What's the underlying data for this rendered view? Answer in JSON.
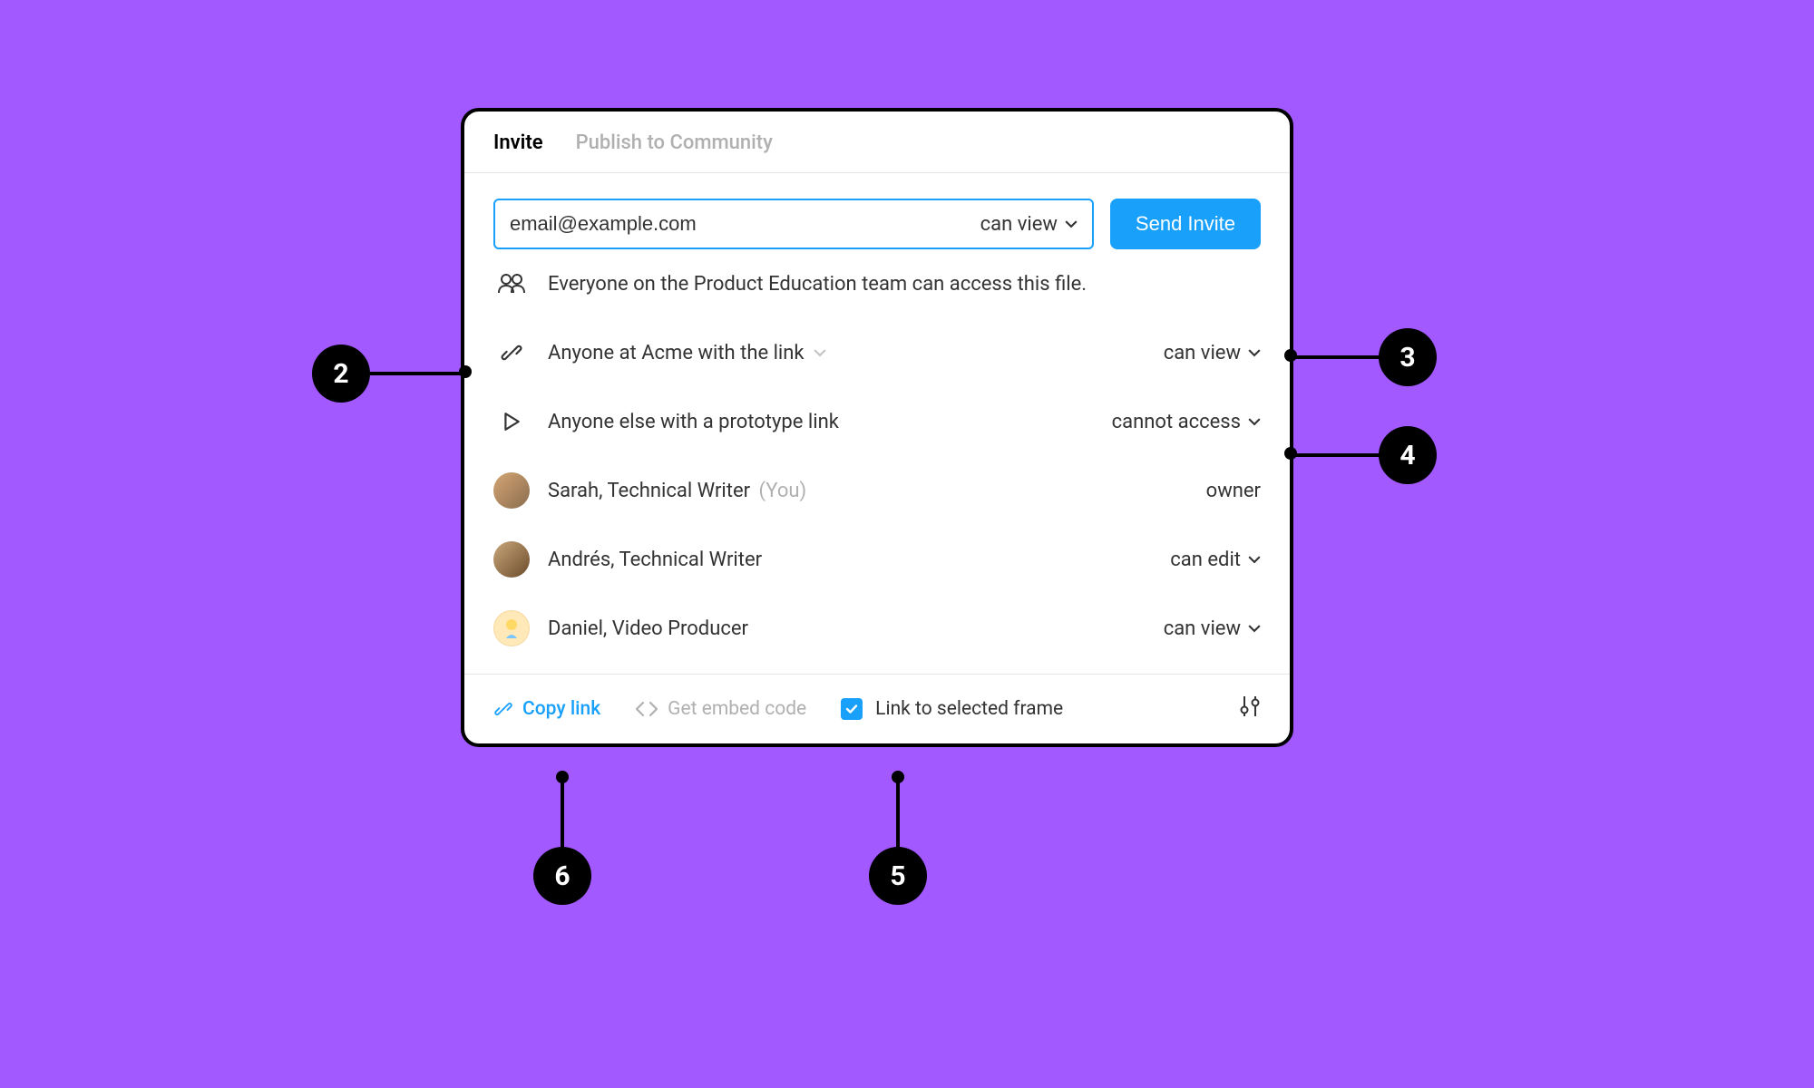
{
  "tabs": {
    "invite": "Invite",
    "publish": "Publish to Community"
  },
  "invite": {
    "email_placeholder": "email@example.com",
    "default_permission": "can view",
    "send_button": "Send Invite"
  },
  "team_access": {
    "text": "Everyone on the Product Education team can access this file."
  },
  "link_access": {
    "label": "Anyone at Acme with the link",
    "permission": "can view"
  },
  "prototype_access": {
    "label": "Anyone else with a prototype link",
    "permission": "cannot access"
  },
  "members": [
    {
      "name": "Sarah, Technical Writer",
      "you": "(You)",
      "permission": "owner",
      "static": true,
      "avatar_bg": "#d4a574"
    },
    {
      "name": "Andrés, Technical Writer",
      "you": "",
      "permission": "can edit",
      "static": false,
      "avatar_bg": "#c9a87c"
    },
    {
      "name": "Daniel, Video Producer",
      "you": "",
      "permission": "can view",
      "static": false,
      "avatar_bg": "#ffe9b8"
    }
  ],
  "footer": {
    "copy_link": "Copy link",
    "embed": "Get embed code",
    "link_frame": "Link to selected frame",
    "link_frame_checked": true
  },
  "annotations": {
    "2": "2",
    "3": "3",
    "4": "4",
    "5": "5",
    "6": "6"
  },
  "colors": {
    "background": "#a259ff",
    "accent": "#18a0fb",
    "text": "#333333",
    "muted": "#b0b0b0"
  }
}
